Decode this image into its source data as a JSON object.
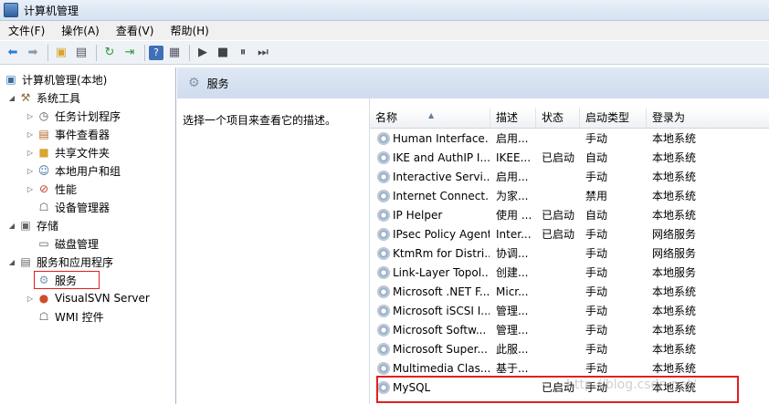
{
  "window": {
    "title": "计算机管理"
  },
  "menu": [
    "文件(F)",
    "操作(A)",
    "查看(V)",
    "帮助(H)"
  ],
  "toolbar": {
    "icons": [
      "back-arrow-icon",
      "forward-arrow-icon",
      "folder-up-icon",
      "show-hide-tree-icon",
      "refresh-icon",
      "export-icon",
      "help-icon",
      "properties-icon",
      "play-icon",
      "stop-icon",
      "pause-icon",
      "restart-icon"
    ]
  },
  "tree": [
    {
      "label": "计算机管理(本地)",
      "icon": "computer-management-icon"
    },
    {
      "label": "系统工具",
      "icon": "tools-icon"
    },
    {
      "label": "任务计划程序",
      "icon": "clock-icon"
    },
    {
      "label": "事件查看器",
      "icon": "event-viewer-icon"
    },
    {
      "label": "共享文件夹",
      "icon": "shared-folder-icon"
    },
    {
      "label": "本地用户和组",
      "icon": "users-icon"
    },
    {
      "label": "性能",
      "icon": "performance-icon"
    },
    {
      "label": "设备管理器",
      "icon": "device-manager-icon"
    },
    {
      "label": "存储",
      "icon": "storage-icon"
    },
    {
      "label": "磁盘管理",
      "icon": "disk-icon"
    },
    {
      "label": "服务和应用程序",
      "icon": "services-apps-icon"
    },
    {
      "label": "服务",
      "icon": "services-gear-icon"
    },
    {
      "label": "VisualSVN Server",
      "icon": "visualsvn-icon"
    },
    {
      "label": "WMI 控件",
      "icon": "wmi-icon"
    }
  ],
  "panel": {
    "title": "服务",
    "description": "选择一个项目来查看它的描述。"
  },
  "columns": [
    "名称",
    "描述",
    "状态",
    "启动类型",
    "登录为"
  ],
  "services": [
    {
      "name": "Human Interface...",
      "desc": "启用...",
      "status": "",
      "startup": "手动",
      "logon": "本地系统"
    },
    {
      "name": "IKE and AuthIP I...",
      "desc": "IKEE...",
      "status": "已启动",
      "startup": "自动",
      "logon": "本地系统"
    },
    {
      "name": "Interactive Servi...",
      "desc": "启用...",
      "status": "",
      "startup": "手动",
      "logon": "本地系统"
    },
    {
      "name": "Internet Connect...",
      "desc": "为家...",
      "status": "",
      "startup": "禁用",
      "logon": "本地系统"
    },
    {
      "name": "IP Helper",
      "desc": "使用 ...",
      "status": "已启动",
      "startup": "自动",
      "logon": "本地系统"
    },
    {
      "name": "IPsec Policy Agent",
      "desc": "Inter...",
      "status": "已启动",
      "startup": "手动",
      "logon": "网络服务"
    },
    {
      "name": "KtmRm for Distri...",
      "desc": "协调...",
      "status": "",
      "startup": "手动",
      "logon": "网络服务"
    },
    {
      "name": "Link-Layer Topol...",
      "desc": "创建...",
      "status": "",
      "startup": "手动",
      "logon": "本地服务"
    },
    {
      "name": "Microsoft .NET F...",
      "desc": "Micr...",
      "status": "",
      "startup": "手动",
      "logon": "本地系统"
    },
    {
      "name": "Microsoft iSCSI I...",
      "desc": "管理...",
      "status": "",
      "startup": "手动",
      "logon": "本地系统"
    },
    {
      "name": "Microsoft Softw...",
      "desc": "管理...",
      "status": "",
      "startup": "手动",
      "logon": "本地系统"
    },
    {
      "name": "Microsoft Super...",
      "desc": "此服...",
      "status": "",
      "startup": "手动",
      "logon": "本地系统"
    },
    {
      "name": "Multimedia Clas...",
      "desc": "基于...",
      "status": "",
      "startup": "手动",
      "logon": "本地系统"
    },
    {
      "name": "MySQL",
      "desc": "",
      "status": "已启动",
      "startup": "手动",
      "logon": "本地系统"
    }
  ],
  "watermark": "http://blog.csdn.net/"
}
